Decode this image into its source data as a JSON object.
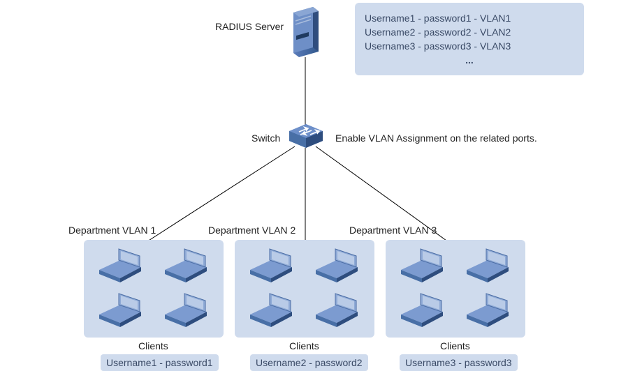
{
  "server": {
    "label": "RADIUS Server"
  },
  "config_panel": {
    "lines": [
      "Username1 - password1 - VLAN1",
      "Username2 - password2 - VLAN2",
      "Username3 - password3 - VLAN3",
      "..."
    ]
  },
  "switch": {
    "label": "Switch",
    "note": "Enable VLAN Assignment on the related ports."
  },
  "departments": [
    {
      "title": "Department VLAN 1",
      "clients_label": "Clients",
      "cred": "Username1 - password1"
    },
    {
      "title": "Department VLAN 2",
      "clients_label": "Clients",
      "cred": "Username2 - password2"
    },
    {
      "title": "Department VLAN 3",
      "clients_label": "Clients",
      "cred": "Username3 - password3"
    }
  ]
}
